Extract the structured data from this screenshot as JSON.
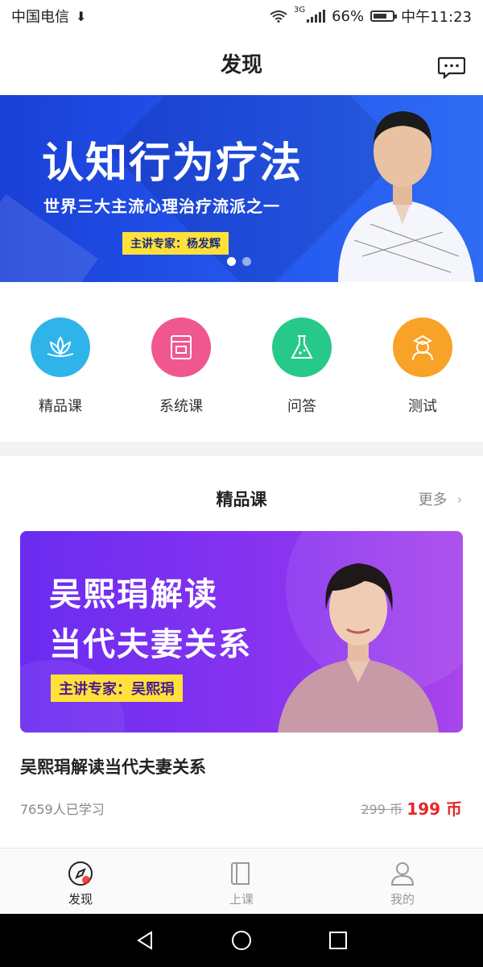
{
  "status_bar": {
    "carrier": "中国电信",
    "network": "3G",
    "battery": "66%",
    "time": "中午11:23"
  },
  "header": {
    "title": "发现",
    "message_icon": "message-icon"
  },
  "banner": {
    "title": "认知行为疗法",
    "subtitle": "世界三大主流心理治疗流派之一",
    "expert": "主讲专家：杨发辉",
    "slide_count": 2,
    "active_slide": 1
  },
  "categories": [
    {
      "label": "精品课",
      "icon": "lotus-icon",
      "color": "#2fb4ea"
    },
    {
      "label": "系统课",
      "icon": "book-icon",
      "color": "#f1578f"
    },
    {
      "label": "问答",
      "icon": "flask-icon",
      "color": "#27c98a"
    },
    {
      "label": "测试",
      "icon": "doctor-icon",
      "color": "#f8a227"
    }
  ],
  "section": {
    "title": "精品课",
    "more": "更多"
  },
  "course": {
    "banner_line1": "吴熙琄解读",
    "banner_line2": "当代夫妻关系",
    "banner_expert": "主讲专家：吴熙琄",
    "name": "吴熙琄解读当代夫妻关系",
    "learners": "7659人已学习",
    "original_price": "299 币",
    "price": "199 币"
  },
  "tabbar": [
    {
      "label": "发现",
      "icon": "compass-icon",
      "active": true
    },
    {
      "label": "上课",
      "icon": "book-icon",
      "active": false
    },
    {
      "label": "我的",
      "icon": "user-icon",
      "active": false
    }
  ],
  "colors": {
    "banner_blue": "#2458f0",
    "course_purple": "#8a34f0",
    "price_red": "#e6262a",
    "badge_yellow": "#ffe13a"
  }
}
